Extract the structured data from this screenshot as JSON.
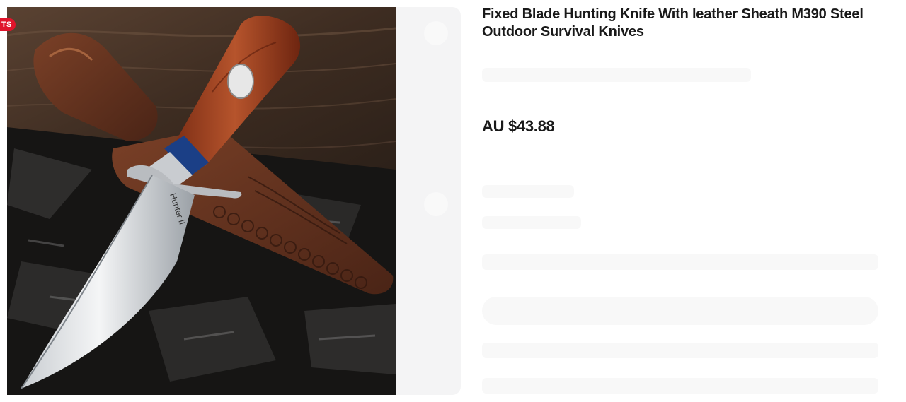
{
  "badge": {
    "label": "TS"
  },
  "product": {
    "title": "Fixed Blade Hunting Knife With leather Sheath M390 Steel Outdoor Survival Knives",
    "price": "AU $43.88"
  },
  "image": {
    "blade_text": "Hunter II"
  },
  "colors": {
    "badge": "#e0142b",
    "text": "#191919",
    "panel": "#f4f4f5"
  }
}
